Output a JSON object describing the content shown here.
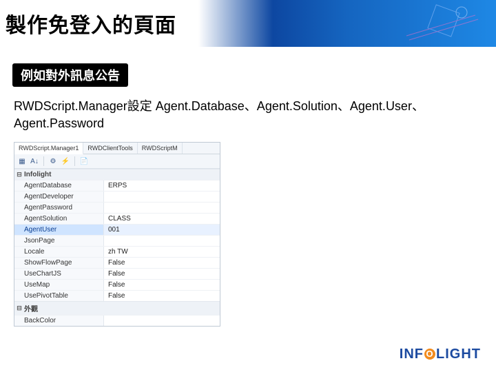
{
  "header": {
    "title": "製作免登入的頁面"
  },
  "subheader": "例如對外訊息公告",
  "description": "RWDScript.Manager設定 Agent.Database、Agent.Solution、Agent.User、Agent.Password",
  "props": {
    "tabs": [
      {
        "label": "RWDScript.Manager1"
      },
      {
        "label": "RWDClientTools"
      },
      {
        "label": "RWDScriptM"
      }
    ],
    "activeTab": 0,
    "toolbar": {
      "cat_icon": "▦",
      "az_icon": "A↓",
      "props_icon": "⚙",
      "events_icon": "⚡",
      "pages_icon": "📄"
    },
    "cat1": {
      "twist": "⊟",
      "label": "Infolight"
    },
    "rows": [
      {
        "name": "AgentDatabase",
        "value": "ERPS",
        "selected": false
      },
      {
        "name": "AgentDeveloper",
        "value": "",
        "selected": false
      },
      {
        "name": "AgentPassword",
        "value": "",
        "selected": false
      },
      {
        "name": "AgentSolution",
        "value": "CLASS",
        "selected": false
      },
      {
        "name": "AgentUser",
        "value": "001",
        "selected": true
      },
      {
        "name": "JsonPage",
        "value": "",
        "selected": false
      },
      {
        "name": "Locale",
        "value": "zh TW",
        "selected": false
      },
      {
        "name": "ShowFlowPage",
        "value": "False",
        "selected": false
      },
      {
        "name": "UseChartJS",
        "value": "False",
        "selected": false
      },
      {
        "name": "UseMap",
        "value": "False",
        "selected": false
      },
      {
        "name": "UsePivotTable",
        "value": "False",
        "selected": false
      }
    ],
    "cat2": {
      "twist": "⊟",
      "label": "外觀"
    },
    "rows2": [
      {
        "name": "BackColor",
        "value": "",
        "selected": false
      }
    ]
  },
  "footer": {
    "brand_left": "INF",
    "brand_o": "O",
    "brand_right": "LIGHT"
  }
}
